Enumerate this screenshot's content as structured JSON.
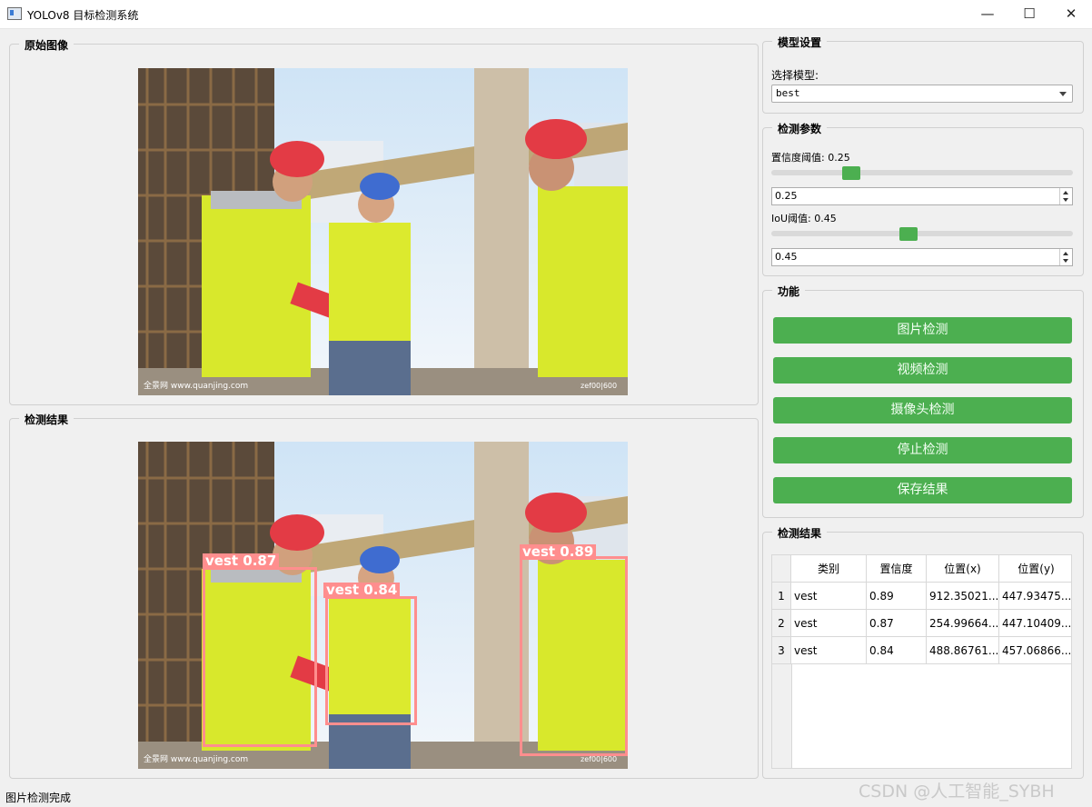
{
  "window": {
    "title": "YOLOv8 目标检测系统",
    "minimize": "—",
    "maximize": "☐",
    "close": "✕"
  },
  "original_panel": {
    "title": "原始图像"
  },
  "result_panel": {
    "title": "检测结果"
  },
  "image_watermark": {
    "left": "全景网  www.quanjing.com",
    "right": "zef00|600"
  },
  "detections": [
    {
      "label": "vest 0.89",
      "class": "vest",
      "confidence": 0.89
    },
    {
      "label": "vest 0.87",
      "class": "vest",
      "confidence": 0.87
    },
    {
      "label": "vest 0.84",
      "class": "vest",
      "confidence": 0.84
    }
  ],
  "model_settings": {
    "title": "模型设置",
    "select_label": "选择模型:",
    "selected_model": "best"
  },
  "detect_params": {
    "title": "检测参数",
    "confidence_label": "置信度阈值: 0.25",
    "confidence_value": "0.25",
    "confidence_level": 0.25,
    "iou_label": "IoU阈值: 0.45",
    "iou_value": "0.45",
    "iou_level": 0.45
  },
  "functions": {
    "title": "功能",
    "image_detect": "图片检测",
    "video_detect": "视频检测",
    "camera_detect": "摄像头检测",
    "stop_detect": "停止检测",
    "save_results": "保存结果"
  },
  "results_table": {
    "title": "检测结果",
    "headers": [
      "类别",
      "置信度",
      "位置(x)",
      "位置(y)"
    ],
    "rows": [
      {
        "index": "1",
        "class": "vest",
        "confidence": "0.89",
        "x": "912.35021...",
        "y": "447.93475..."
      },
      {
        "index": "2",
        "class": "vest",
        "confidence": "0.87",
        "x": "254.99664...",
        "y": "447.10409..."
      },
      {
        "index": "3",
        "class": "vest",
        "confidence": "0.84",
        "x": "488.86761...",
        "y": "457.06866..."
      }
    ]
  },
  "status": {
    "text": "图片检测完成"
  },
  "watermark": {
    "text": "CSDN @人工智能_SYBH"
  },
  "colors": {
    "accent_green": "#4caf50",
    "box_color": "#ff8e8e"
  }
}
